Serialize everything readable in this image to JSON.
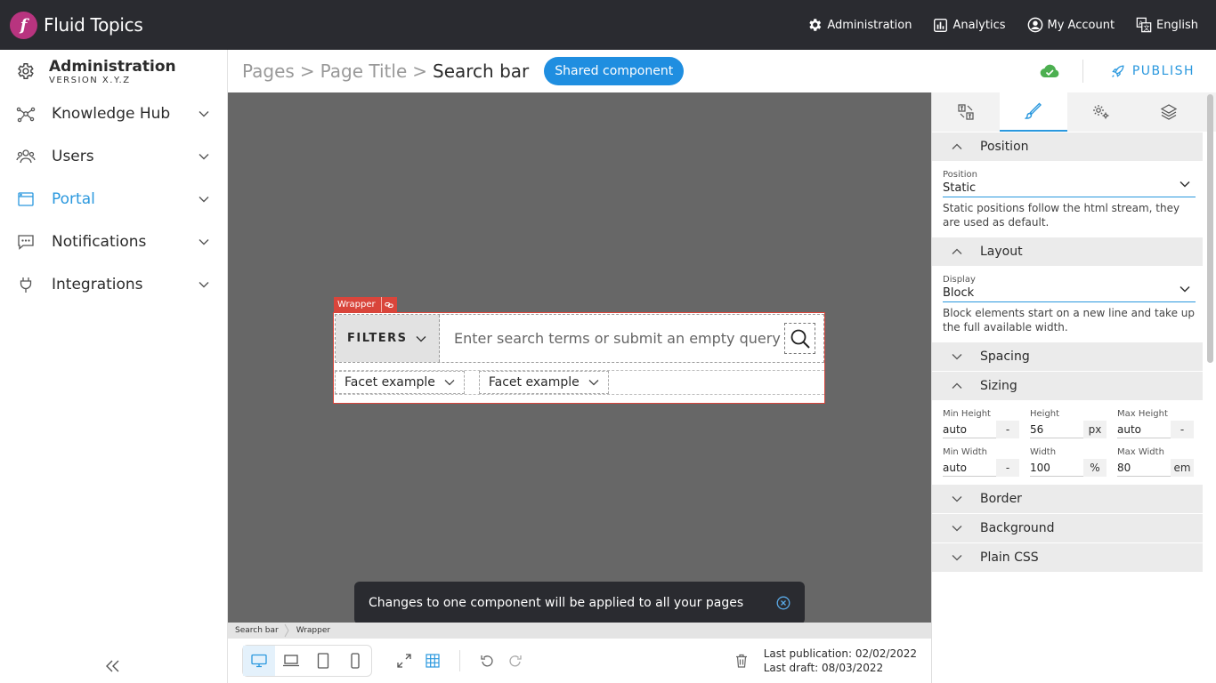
{
  "app": {
    "name": "Fluid Topics",
    "logo_letter": "f"
  },
  "topnav": {
    "administration": "Administration",
    "analytics": "Analytics",
    "my_account": "My Account",
    "language": "English"
  },
  "sidebar": {
    "title": "Administration",
    "version": "VERSION X.Y.Z",
    "items": [
      {
        "label": "Knowledge Hub"
      },
      {
        "label": "Users"
      },
      {
        "label": "Portal"
      },
      {
        "label": "Notifications"
      },
      {
        "label": "Integrations"
      }
    ],
    "collapse": "«"
  },
  "header": {
    "crumb_1": "Pages",
    "crumb_2": "Page Title",
    "separator": ">",
    "current": "Search bar",
    "badge": "Shared component",
    "publish": "PUBLISH"
  },
  "canvas": {
    "wrapper_tag": "Wrapper",
    "filters": "FILTERS",
    "search_placeholder": "Enter search terms or submit an empty query",
    "facets": [
      {
        "label": "Facet example"
      },
      {
        "label": "Facet example"
      }
    ],
    "toast": "Changes to one component will be applied to all your pages"
  },
  "pathbar": {
    "items": [
      "Search bar",
      "Wrapper"
    ]
  },
  "bottombar": {
    "last_publication": "Last publication: 02/02/2022",
    "last_draft": "Last draft: 08/03/2022"
  },
  "panel": {
    "position": {
      "title": "Position",
      "field_label": "Position",
      "value": "Static",
      "help": "Static positions follow the html stream, they are used as default."
    },
    "layout": {
      "title": "Layout",
      "field_label": "Display",
      "value": "Block",
      "help": "Block elements start on a new line and take up the full available width."
    },
    "spacing": {
      "title": "Spacing"
    },
    "sizing": {
      "title": "Sizing",
      "fields": [
        {
          "label": "Min Height",
          "value": "auto",
          "unit": "-"
        },
        {
          "label": "Height",
          "value": "56",
          "unit": "px"
        },
        {
          "label": "Max Height",
          "value": "auto",
          "unit": "-"
        },
        {
          "label": "Min Width",
          "value": "auto",
          "unit": "-"
        },
        {
          "label": "Width",
          "value": "100",
          "unit": "%"
        },
        {
          "label": "Max Width",
          "value": "80",
          "unit": "em"
        }
      ]
    },
    "border": {
      "title": "Border"
    },
    "background": {
      "title": "Background"
    },
    "plain_css": {
      "title": "Plain CSS"
    }
  },
  "colors": {
    "topbar": "#2a2b30",
    "brand": "#b8347f",
    "accent": "#2a98de",
    "badge": "#1f8ee0",
    "wrapper": "#d9453b",
    "canvas": "#676767",
    "cloud_ok": "#4caf50"
  }
}
